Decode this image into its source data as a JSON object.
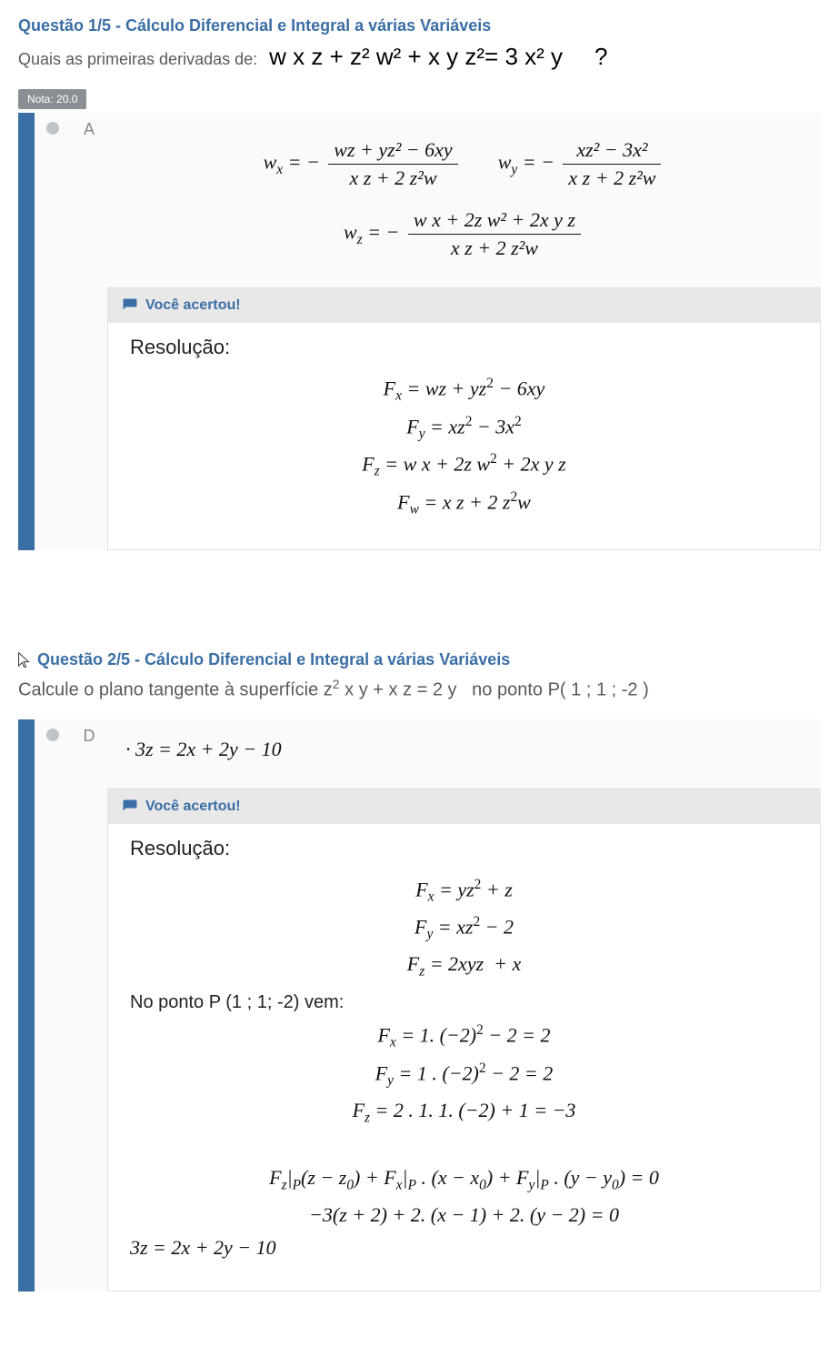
{
  "q1": {
    "title": "Questão 1/5 - Cálculo Diferencial e Integral a várias Variáveis",
    "prompt_prefix": "Quais as primeiras derivadas de:",
    "prompt_math": "w x z + z² w² + x y z²= 3 x² y",
    "prompt_suffix": "?",
    "nota": "Nota: 20.0",
    "letter": "A",
    "formula_wx_num": "wz + yz² − 6xy",
    "formula_wx_den": "x z + 2 z²w",
    "formula_wy_num": "xz² − 3x²",
    "formula_wy_den": "x z + 2 z²w",
    "formula_wz_num": "w x + 2z w² + 2x y z",
    "formula_wz_den": "x z + 2 z²w",
    "feedback": "Você acertou!",
    "resolution_label": "Resolução:",
    "lines": {
      "fx": "Fₓ = wz + yz² − 6xy",
      "fy": "Fᵧ = xz² − 3x²",
      "fz": "F_z = w x + 2z w² + 2x y z",
      "fw": "F_w = x z + 2 z²w"
    }
  },
  "q2": {
    "title": "Questão 2/5 - Cálculo Diferencial e Integral a várias Variáveis",
    "prompt": "Calcule o plano tangente à superfície z² x y + x z = 2 y   no ponto P( 1 ; 1 ; -2 )",
    "letter": "D",
    "answer": "3z = 2x + 2y − 10",
    "feedback": "Você acertou!",
    "resolution_label": "Resolução:",
    "lines": {
      "fx": "Fₓ = yz² + z",
      "fy": "Fᵧ = xz² − 2",
      "fz": "F_z = 2xyz  + x",
      "point_text": "No ponto P (1 ; 1; -2) vem:",
      "fx_p": "Fₓ = 1. (−2)² − 2 = 2",
      "fy_p": "Fᵧ = 1 . (−2)² − 2 = 2",
      "fz_p": "F_z = 2 . 1. 1. (−2) + 1 = −3",
      "plane_eq": "F_z|ₚ(z − z₀) + Fₓ|ₚ . (x − x₀) + Fᵧ|ₚ . (y − y₀) = 0",
      "substituted": "−3(z + 2) + 2. (x − 1) + 2. (y − 2) = 0",
      "final": "3z = 2x + 2y − 10"
    }
  }
}
